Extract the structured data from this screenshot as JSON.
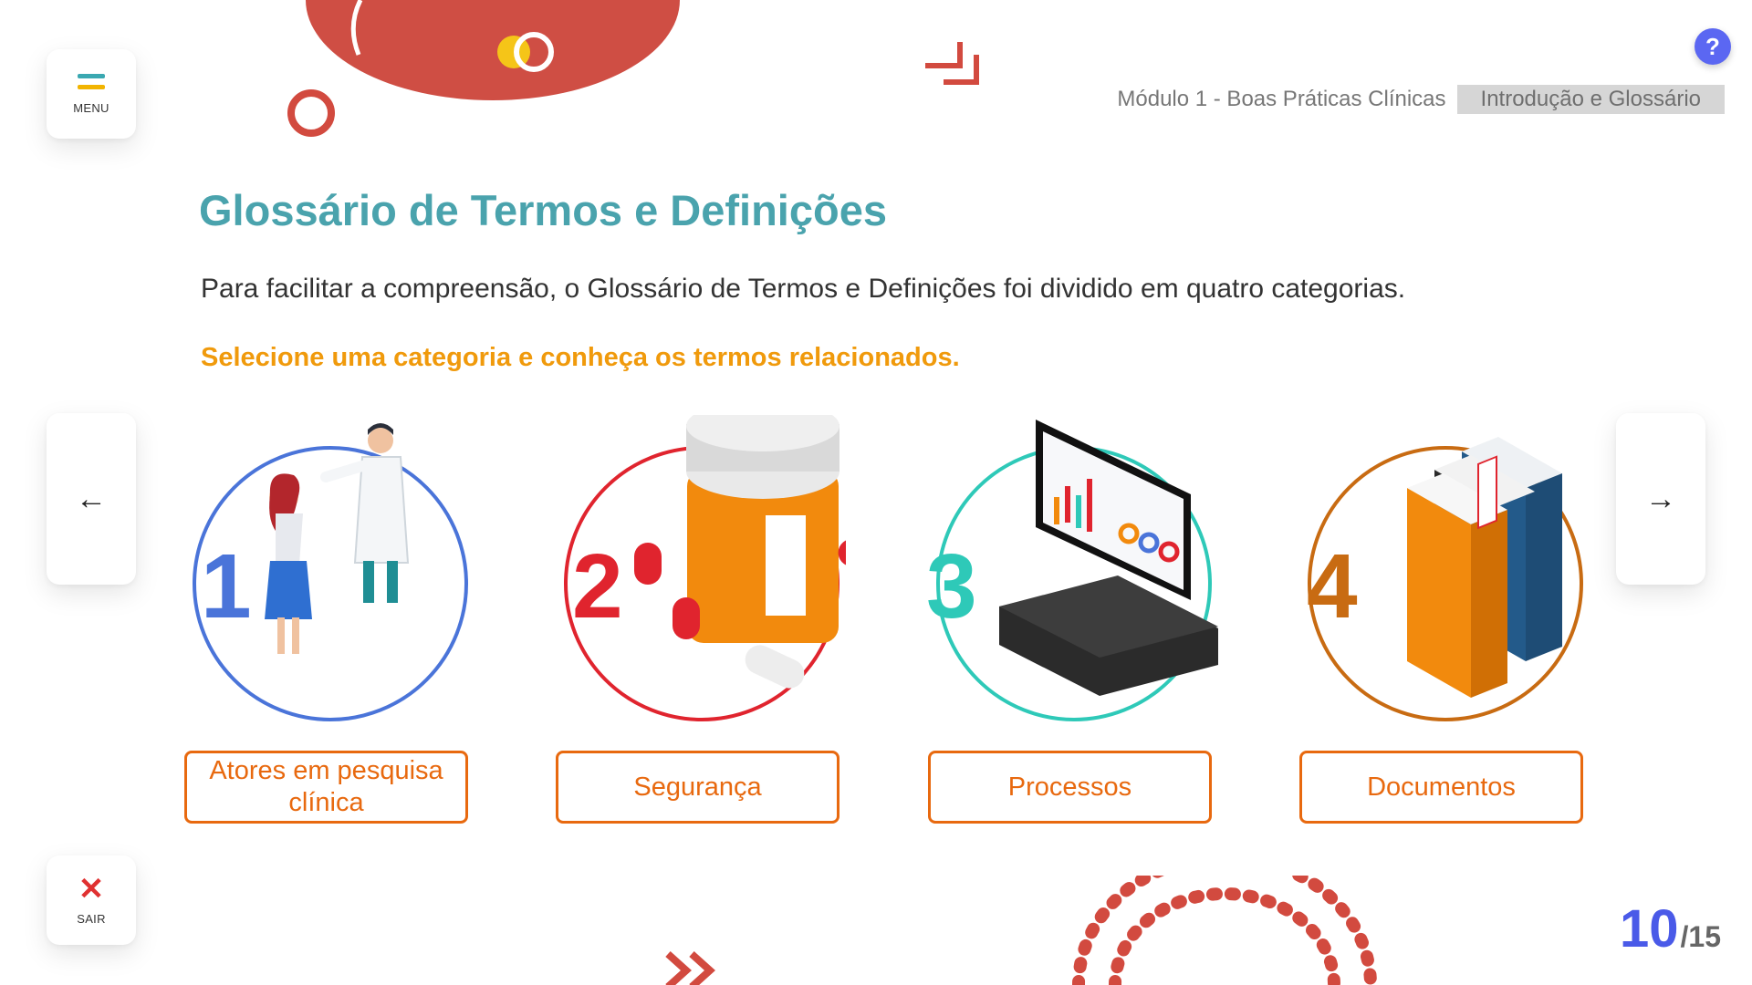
{
  "header": {
    "menu_label": "MENU",
    "help_label": "?",
    "breadcrumb": {
      "module": "Módulo 1 - Boas Práticas Clínicas",
      "section": "Introdução e Glossário"
    }
  },
  "main": {
    "title": "Glossário de Termos e Definições",
    "intro": "Para facilitar a compreensão, o Glossário de Termos e Definições foi dividido em quatro categorias.",
    "instruction": "Selecione uma categoria e conheça os termos relacionados."
  },
  "categories": [
    {
      "number": "1",
      "label": "Atores em pesquisa clínica",
      "color": "#4a74d9",
      "icon": "doctor-patient-icon"
    },
    {
      "number": "2",
      "label": "Segurança",
      "color": "#e0242e",
      "icon": "pill-bottle-icon"
    },
    {
      "number": "3",
      "label": "Processos",
      "color": "#2ec9b8",
      "icon": "computer-icon"
    },
    {
      "number": "4",
      "label": "Documentos",
      "color": "#c86b12",
      "icon": "binders-icon"
    }
  ],
  "navigation": {
    "prev_icon": "←",
    "next_icon": "→"
  },
  "footer": {
    "exit_label": "SAIR",
    "exit_icon": "✕",
    "page_current": "10",
    "page_total": "/15"
  },
  "colors": {
    "accent_teal": "#4aa3ad",
    "accent_orange": "#e8690f",
    "instruction_orange": "#f09a0c",
    "help_blue": "#5b67f2",
    "deco_red": "#d24a3f"
  }
}
